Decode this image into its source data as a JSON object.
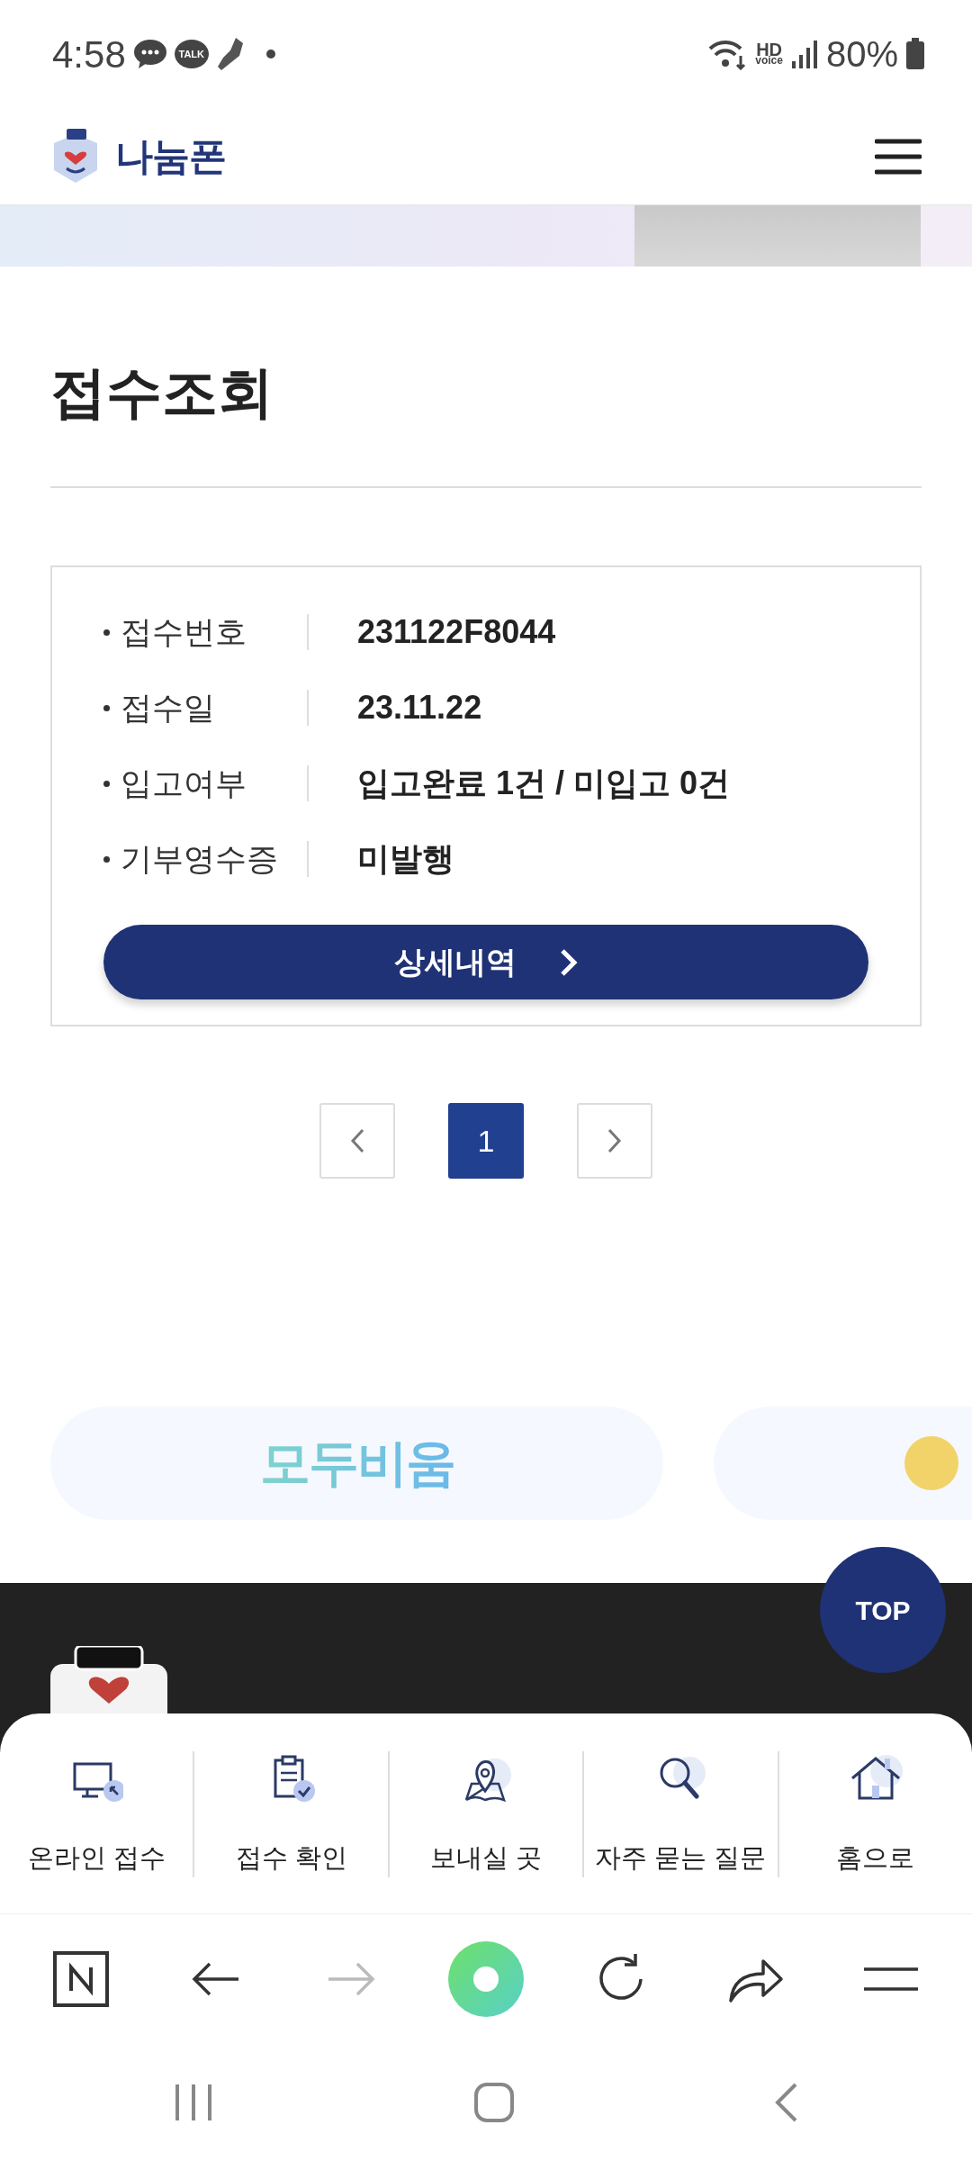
{
  "status_bar": {
    "time": "4:58",
    "talk_badge": "TALK",
    "network_top": "HD",
    "network_bottom": "voice",
    "battery": "80%"
  },
  "header": {
    "logo_text": "나눔폰"
  },
  "page_title": "접수조회",
  "receipt": {
    "fields": [
      {
        "label": "접수번호",
        "value": "231122F8044"
      },
      {
        "label": "접수일",
        "value": "23.11.22"
      },
      {
        "label": "입고여부",
        "value": "입고완료 1건 / 미입고 0건"
      },
      {
        "label": "기부영수증",
        "value": "미발행"
      }
    ],
    "detail_button": "상세내역"
  },
  "pagination": {
    "pages": [
      {
        "label": "1",
        "selected": true
      }
    ]
  },
  "partners": [
    {
      "kind": "wordmark",
      "name": "모두비움"
    },
    {
      "kind": "image"
    }
  ],
  "top_button": "TOP",
  "quick_menu": [
    {
      "kind": "monitor",
      "label": "온라인 접수"
    },
    {
      "kind": "clipboard",
      "label": "접수 확인"
    },
    {
      "kind": "map",
      "label": "보내실 곳"
    },
    {
      "kind": "search",
      "label": "자주 묻는 질문"
    },
    {
      "kind": "home",
      "label": "홈으로"
    }
  ],
  "browser_toolbar": {
    "forward_disabled": true
  }
}
